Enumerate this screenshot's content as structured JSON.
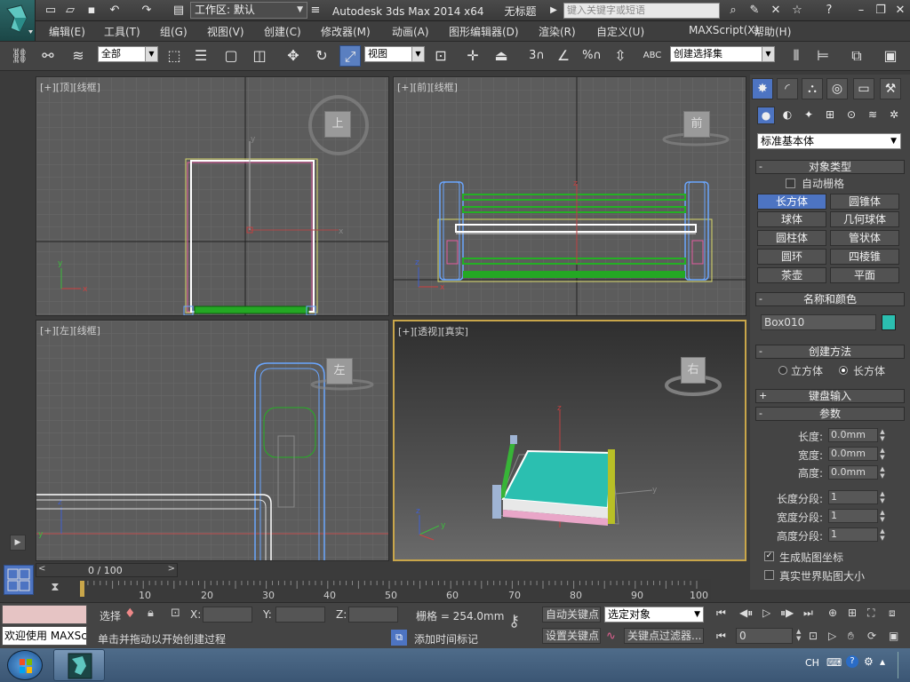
{
  "titlebar": {
    "workspace_value": "工作区: 默认",
    "app_title": "Autodesk 3ds Max  2014 x64",
    "doc_title": "无标题",
    "search_placeholder": "键入关键字或短语"
  },
  "menubar": {
    "items": [
      "编辑(E)",
      "工具(T)",
      "组(G)",
      "视图(V)",
      "创建(C)",
      "修改器(M)",
      "动画(A)",
      "图形编辑器(D)",
      "渲染(R)",
      "自定义(U)",
      "MAXScript(X)",
      "帮助(H)"
    ]
  },
  "toolbar": {
    "selection_filter": "全部",
    "ref_coord": "视图",
    "named_selection": "创建选择集"
  },
  "viewports": {
    "top": {
      "label": "[+][顶][线框]",
      "viewcube": "上"
    },
    "front": {
      "label": "[+][前][线框]",
      "viewcube": "前"
    },
    "left": {
      "label": "[+][左][线框]",
      "viewcube": "左"
    },
    "persp": {
      "label": "[+][透视][真实]",
      "viewcube": "右"
    }
  },
  "command_panel": {
    "category": "标准基本体",
    "object_type": {
      "title": "对象类型",
      "autogrid": "自动栅格",
      "buttons": [
        "长方体",
        "圆锥体",
        "球体",
        "几何球体",
        "圆柱体",
        "管状体",
        "圆环",
        "四棱锥",
        "茶壶",
        "平面"
      ]
    },
    "name_color": {
      "title": "名称和颜色",
      "name": "Box010",
      "color": "#2bbfb0"
    },
    "creation_method": {
      "title": "创建方法",
      "cube": "立方体",
      "box": "长方体"
    },
    "keyboard_entry": "键盘输入",
    "parameters": {
      "title": "参数",
      "length_label": "长度:",
      "length": "0.0mm",
      "width_label": "宽度:",
      "width": "0.0mm",
      "height_label": "高度:",
      "height": "0.0mm",
      "length_segs_label": "长度分段:",
      "length_segs": "1",
      "width_segs_label": "宽度分段:",
      "width_segs": "1",
      "height_segs_label": "高度分段:",
      "height_segs": "1",
      "gen_map_coords": "生成贴图坐标",
      "real_world_map": "真实世界贴图大小"
    }
  },
  "timeline": {
    "slider": "0 / 100",
    "ticks": [
      "10",
      "20",
      "30",
      "40",
      "50",
      "60",
      "70",
      "80",
      "90",
      "100"
    ]
  },
  "status": {
    "maxscript_welcome": "欢迎使用 MAXSc",
    "select_label": "选择",
    "x_label": "X:",
    "y_label": "Y:",
    "z_label": "Z:",
    "grid": "栅格 = 254.0mm",
    "prompt": "单击并拖动以开始创建过程",
    "add_time_tag": "添加时间标记",
    "auto_key": "自动关键点",
    "set_key": "设置关键点",
    "key_mode": "选定对象",
    "key_filters": "关键点过滤器...",
    "frame": "0"
  },
  "taskbar": {
    "lang": "CH"
  }
}
